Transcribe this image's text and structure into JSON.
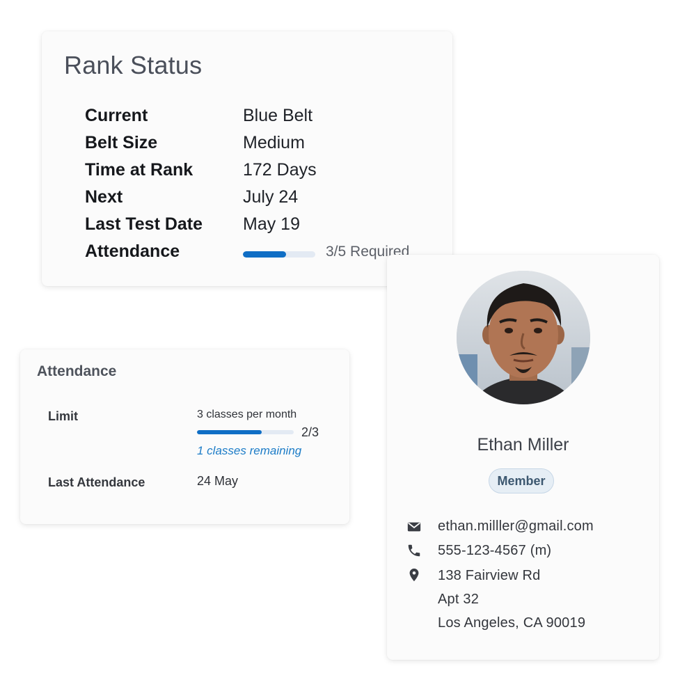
{
  "rank": {
    "title": "Rank Status",
    "rows": [
      {
        "label": "Current",
        "value": "Blue Belt"
      },
      {
        "label": "Belt Size",
        "value": "Medium"
      },
      {
        "label": "Time at Rank",
        "value": "172 Days"
      },
      {
        "label": "Next",
        "value": "July 24"
      },
      {
        "label": "Last Test Date",
        "value": "May 19"
      }
    ],
    "attendance": {
      "label": "Attendance",
      "progress_text": "3/5 Required",
      "progress_fraction": 0.6,
      "color": "#0f6ec5"
    }
  },
  "attendance_card": {
    "title": "Attendance",
    "limit_label": "Limit",
    "limit_value": "3 classes per month",
    "count": "2/3",
    "progress_fraction": 0.6667,
    "remaining": "1 classes remaining",
    "last_label": "Last Attendance",
    "last_value": "24 May"
  },
  "profile": {
    "name": "Ethan Miller",
    "badge": "Member",
    "email": "ethan.milller@gmail.com",
    "phone": "555-123-4567 (m)",
    "address_line1": "138 Fairview Rd",
    "address_line2": "Apt 32",
    "address_line3": "Los Angeles, CA 90019",
    "icons": {
      "email": "envelope-icon",
      "phone": "phone-icon",
      "address": "map-pin-icon"
    }
  }
}
